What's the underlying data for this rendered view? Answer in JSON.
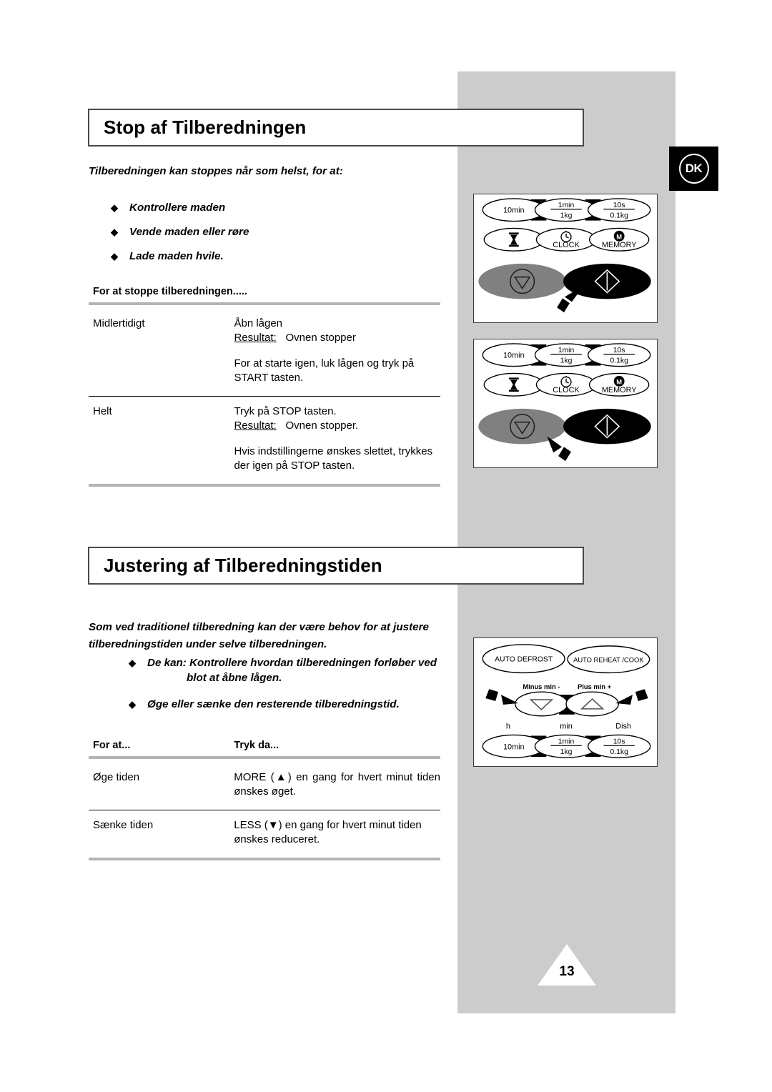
{
  "language_badge": "DK",
  "page_number": "13",
  "sections": [
    {
      "id": "stop",
      "heading": "Stop af Tilberedningen",
      "intro": "Tilberedningen kan stoppes når som helst, for at:",
      "bullets": [
        "Kontrollere maden",
        "Vende maden eller røre",
        "Lade maden hvile."
      ],
      "table": {
        "headers": [
          "For at stoppe tilberedningen.....",
          ""
        ],
        "rows": [
          {
            "label": "Midlertidigt",
            "line1": "Åbn lågen",
            "result_label": "Resultat:",
            "result_text": "Ovnen stopper",
            "extra": "For at starte igen, luk lågen og tryk på START tasten."
          },
          {
            "label": "Helt",
            "line1": "Tryk på STOP tasten.",
            "result_label": "Resultat:",
            "result_text": "Ovnen stopper.",
            "extra": "Hvis indstillingerne ønskes slettet, trykkes der igen på STOP tasten."
          }
        ]
      }
    },
    {
      "id": "adjust",
      "heading": "Justering af Tilberedningstiden",
      "intro": "Som ved traditionel tilberedning kan der være behov for at justere tilberedningstiden under selve tilberedningen.",
      "bullets": [
        "De kan: Kontrollere hvordan tilberedningen forløber ved",
        "blot at åbne lågen.",
        "Øge eller sænke den resterende tilberedningstid."
      ],
      "table": {
        "headers": [
          "For at...",
          "Tryk da..."
        ],
        "rows": [
          {
            "label": "Øge tiden",
            "action": "MORE (▲) en gang for hvert minut tiden ønskes øget."
          },
          {
            "label": "Sænke tiden",
            "action": "LESS (▼) en gang for hvert minut tiden ønskes reduceret."
          }
        ]
      }
    }
  ],
  "figures": {
    "panel_1": {
      "caption_keys": [
        "10min",
        "1min",
        "1kg",
        "10s",
        "0.1kg"
      ],
      "row2": [
        "hourglass",
        "CLOCK",
        "MEMORY"
      ],
      "stop_button": "stop-oval",
      "start_button": "start-oval",
      "pointer_target": "start-button"
    },
    "panel_2": {
      "caption_keys": [
        "10min",
        "1min",
        "1kg",
        "10s",
        "0.1kg"
      ],
      "row2": [
        "hourglass",
        "CLOCK",
        "MEMORY"
      ],
      "stop_button": "stop-oval",
      "start_button": "start-oval",
      "pointer_target": "stop-button"
    },
    "panel_3": {
      "row1": [
        "AUTO DEFROST",
        "AUTO REHEAT /COOK"
      ],
      "row2_labels": [
        "Minus min -",
        "Plus min +"
      ],
      "row3_labels": [
        "h",
        "min",
        "Dish"
      ],
      "row3_keys": [
        "10min",
        "1min",
        "1kg",
        "10s",
        "0.1kg"
      ],
      "pointer_target": "minus-and-plus-buttons"
    }
  },
  "labels": {
    "k_10min": "10min",
    "k_1min": "1min",
    "k_1kg": "1kg",
    "k_10s": "10s",
    "k_01kg": "0.1kg",
    "k_clock": "CLOCK",
    "k_memory": "MEMORY",
    "k_auto_defrost": "AUTO DEFROST",
    "k_auto_reheat": "AUTO REHEAT /COOK",
    "k_minus": "Minus min -",
    "k_plus": "Plus min +",
    "k_h": "h",
    "k_min": "min",
    "k_dish": "Dish"
  },
  "colors": {
    "gray_panel": "#cccccc",
    "rule_gray": "#b4b4b4",
    "border": "#3c3c3c",
    "stop_button_fill": "#808080",
    "start_button_fill": "#000000"
  }
}
